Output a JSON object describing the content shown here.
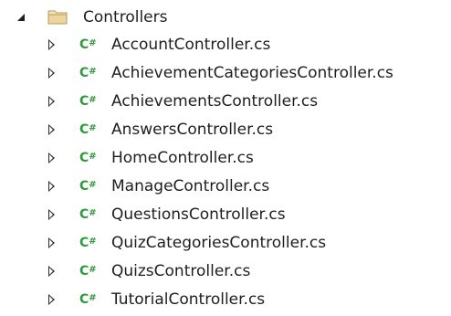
{
  "tree": {
    "folder": {
      "label": "Controllers",
      "icon": "folder-icon",
      "expanded": true,
      "icon_color": "#dcb67a"
    },
    "file_icon": "csharp-file-icon",
    "file_icon_label": "C#",
    "file_icon_color": "#2e9a3c",
    "files": [
      {
        "label": "AccountController.cs"
      },
      {
        "label": "AchievementCategoriesController.cs"
      },
      {
        "label": "AchievementsController.cs"
      },
      {
        "label": "AnswersController.cs"
      },
      {
        "label": "HomeController.cs"
      },
      {
        "label": "ManageController.cs"
      },
      {
        "label": "QuestionsController.cs"
      },
      {
        "label": "QuizCategoriesController.cs"
      },
      {
        "label": "QuizsController.cs"
      },
      {
        "label": "TutorialController.cs"
      }
    ]
  }
}
